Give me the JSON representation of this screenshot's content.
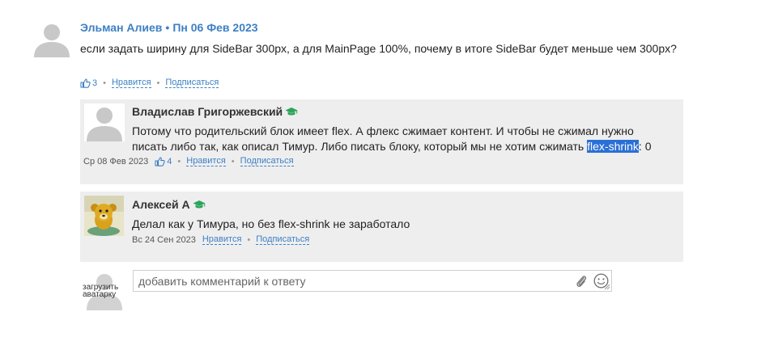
{
  "question": {
    "author": "Эльман Алиев",
    "date": "Пн 06 Фев 2023",
    "text": "если задать ширину для SideBar 300px, а для MainPage 100%, почему в итоге SideBar будет меньше чем 300px?",
    "likes": "3",
    "like_label": "Нравится",
    "subscribe_label": "Подписаться"
  },
  "answers": [
    {
      "author": "Владислав Григоржевский",
      "text_line1": "Потому что родительский блок имеет flex. А флекс сжимает контент. И чтобы не сжимал нужно",
      "text_line2_before": "писать либо так, как описал Тимур. Либо писать блоку, который мы не хотим сжимать ",
      "text_line2_highlight": "flex-shrink",
      "text_line2_after": ": 0",
      "date": "Ср 08 Фев 2023",
      "likes": "4",
      "like_label": "Нравится",
      "subscribe_label": "Подписаться"
    },
    {
      "author": "Алексей А",
      "text": "Делал как у Тимура, но без flex-shrink не заработало",
      "date": "Вс 24 Сен 2023",
      "like_label": "Нравится",
      "subscribe_label": "Подписаться"
    }
  ],
  "comment_form": {
    "placeholder": "добавить комментарий к ответу",
    "upload_avatar_label": "загрузить аватарку"
  },
  "icons": [
    "user-silhouette-icon",
    "thumbs-up-icon",
    "graduation-cap-icon",
    "paperclip-icon",
    "smiley-icon",
    "resize-grip-icon"
  ],
  "colors": {
    "link": "#3d80c4",
    "panel_bg": "#eeeeef",
    "highlight": "#2a6fd6",
    "cap_green": "#2aa55a"
  }
}
